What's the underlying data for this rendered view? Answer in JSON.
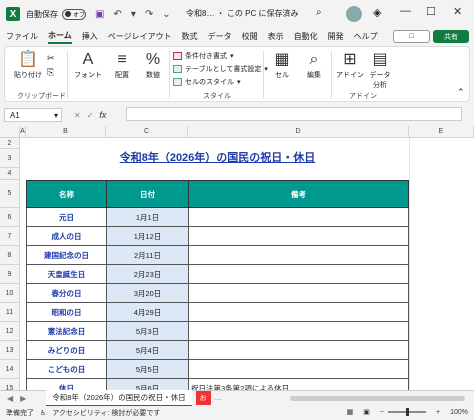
{
  "titlebar": {
    "autosave_label": "自動保存",
    "autosave_state": "オフ",
    "doc_title": "令和8… ・ この PC に保存済み",
    "minimize": "—",
    "maximize": "☐",
    "close": "✕"
  },
  "tabs": [
    "ファイル",
    "ホーム",
    "挿入",
    "ページレイアウト",
    "数式",
    "データ",
    "校閲",
    "表示",
    "自動化",
    "開発",
    "ヘルプ"
  ],
  "active_tab": "ホーム",
  "comment_label": "□",
  "share_label": "共有",
  "ribbon": {
    "paste": "貼り付け",
    "clipboard_group": "クリップボード",
    "font": "フォント",
    "align": "配置",
    "number": "数値",
    "cond_format": "条件付き書式",
    "table_format": "テーブルとして書式設定",
    "cell_style": "セルのスタイル",
    "style_group": "スタイル",
    "cells": "セル",
    "edit": "編集",
    "addin": "アドイン",
    "addin_group": "アドイン",
    "data_analysis_1": "データ",
    "data_analysis_2": "分析"
  },
  "namebox": "A1",
  "fx": "fx",
  "columns": [
    "A",
    "B",
    "C",
    "D",
    "E"
  ],
  "rows": [
    "2",
    "3",
    "4",
    "5",
    "6",
    "7",
    "8",
    "9",
    "10",
    "11",
    "12",
    "13",
    "14",
    "15"
  ],
  "sheet_title": "令和8年（2026年）の国民の祝日・休日",
  "table_headers": [
    "名称",
    "日付",
    "備考"
  ],
  "holidays": [
    {
      "name": "元日",
      "date": "1月1日",
      "note": ""
    },
    {
      "name": "成人の日",
      "date": "1月12日",
      "note": ""
    },
    {
      "name": "建国記念の日",
      "date": "2月11日",
      "note": ""
    },
    {
      "name": "天皇誕生日",
      "date": "2月23日",
      "note": ""
    },
    {
      "name": "春分の日",
      "date": "3月20日",
      "note": ""
    },
    {
      "name": "昭和の日",
      "date": "4月29日",
      "note": ""
    },
    {
      "name": "憲法記念日",
      "date": "5月3日",
      "note": ""
    },
    {
      "name": "みどりの日",
      "date": "5月4日",
      "note": ""
    },
    {
      "name": "こどもの日",
      "date": "5月5日",
      "note": ""
    },
    {
      "name": "休日",
      "date": "5月6日",
      "note": "祝日法第3条第2項による休日"
    }
  ],
  "sheet_tab": "令和8年（2026年）の国民の祝日・休日",
  "sheet_tab2": "お",
  "status": {
    "ready": "準備完了",
    "accessibility": "アクセシビリティ: 検討が必要です",
    "zoom": "100%"
  }
}
